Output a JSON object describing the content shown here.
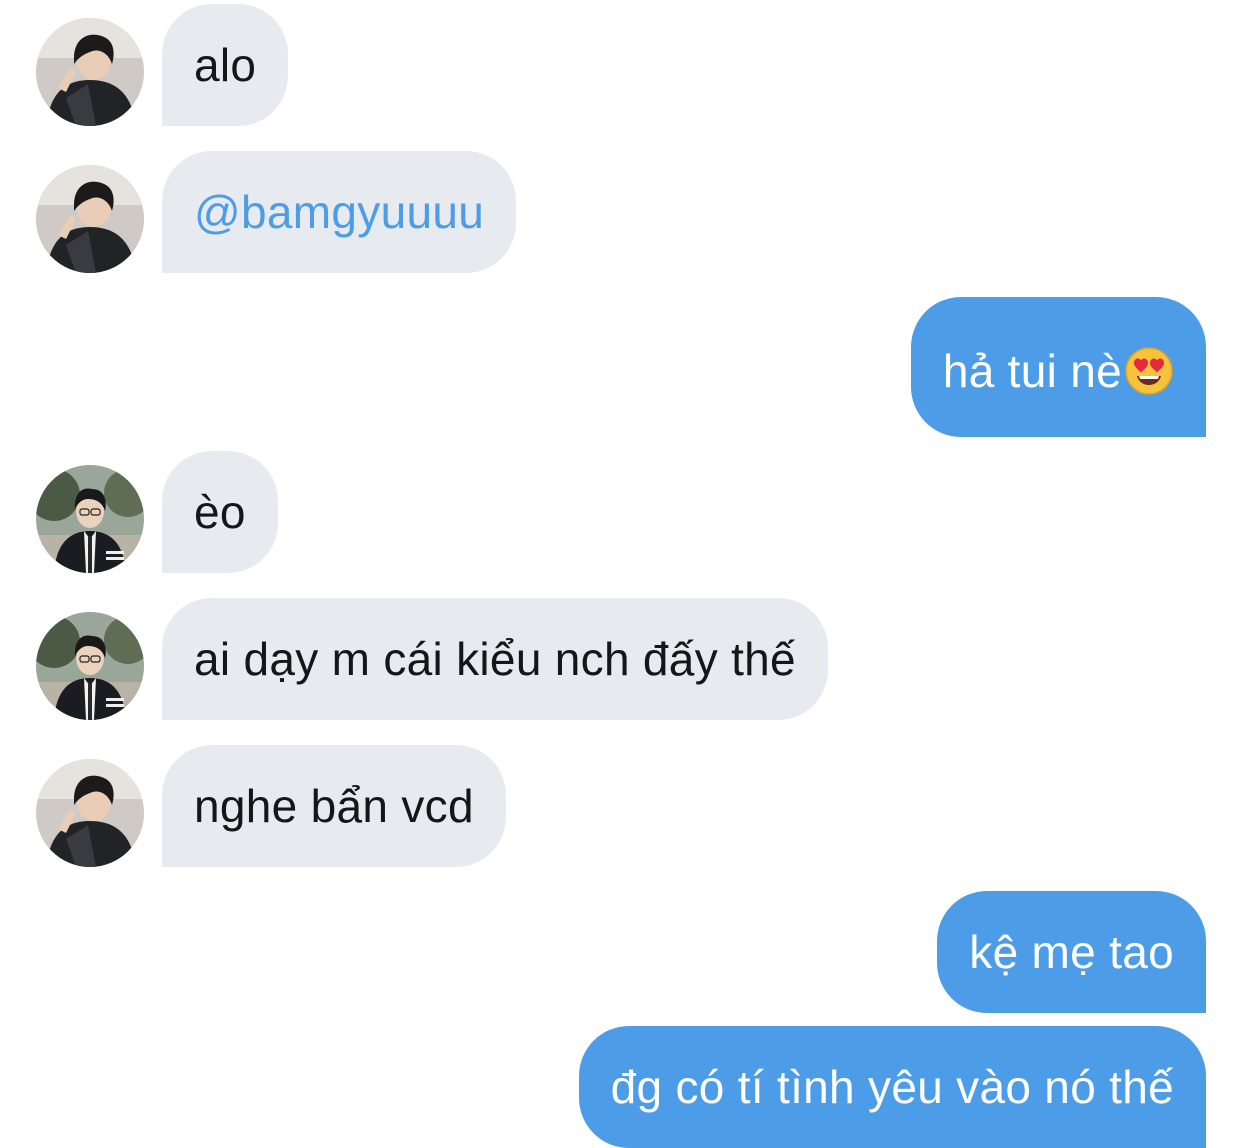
{
  "conversation": {
    "messages": [
      {
        "sender": "other",
        "avatar": "avatar-user-a",
        "text": "alo"
      },
      {
        "sender": "other",
        "avatar": "avatar-user-a",
        "text": "@bamgyuuuu"
      },
      {
        "sender": "me",
        "text": "hả tui nè",
        "emoji": "heart-eyes-emoji"
      },
      {
        "sender": "other",
        "avatar": "avatar-user-b",
        "text": "èo"
      },
      {
        "sender": "other",
        "avatar": "avatar-user-b",
        "text": "ai dạy m cái kiểu nch đấy thế"
      },
      {
        "sender": "other",
        "avatar": "avatar-user-a",
        "text": "nghe bẩn vcd"
      },
      {
        "sender": "me",
        "text": "kệ mẹ tao"
      },
      {
        "sender": "me",
        "text": "đg có tí tình yêu vào nó thế"
      }
    ]
  },
  "colors": {
    "incoming_bubble": "#e7ebef",
    "outgoing_bubble": "#4d9ce8",
    "mention_text": "#4d9ce8",
    "incoming_text": "#14171a",
    "outgoing_text": "#ffffff"
  }
}
